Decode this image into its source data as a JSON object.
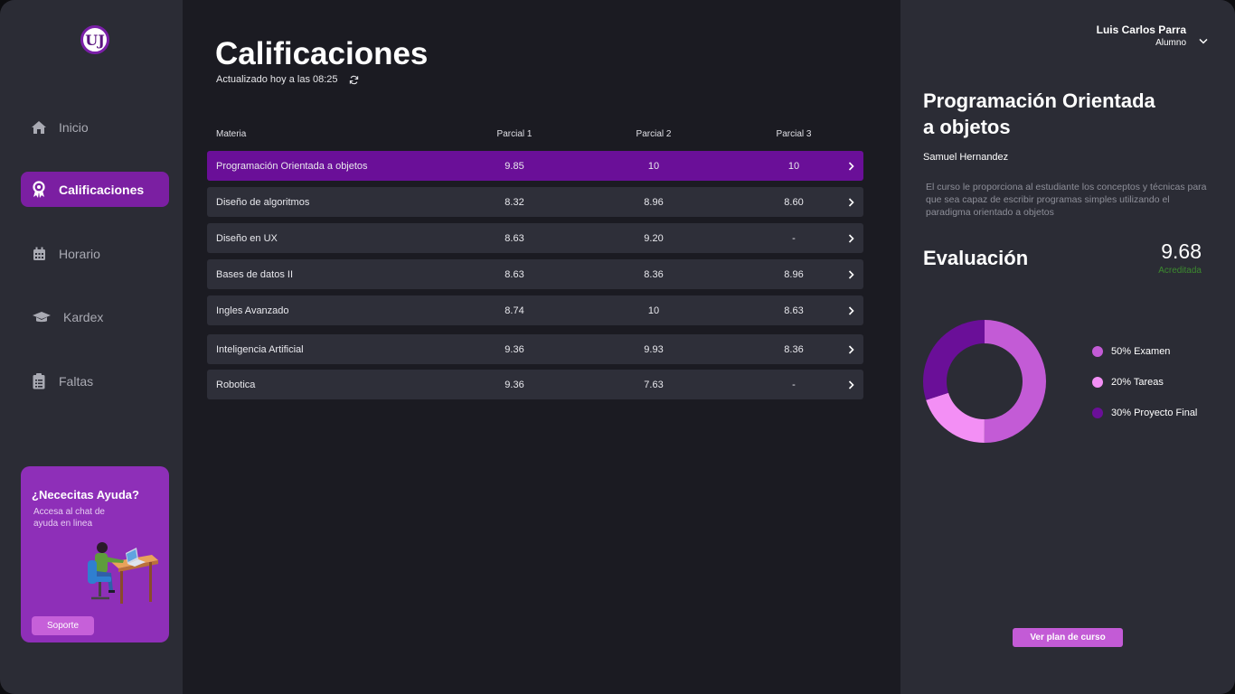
{
  "sidebar": {
    "logo_text": "UJ",
    "nav": [
      {
        "label": "Inicio",
        "icon": "home-icon"
      },
      {
        "label": "Calificaciones",
        "icon": "award-icon",
        "active": true
      },
      {
        "label": "Horario",
        "icon": "calendar-icon"
      },
      {
        "label": "Kardex",
        "icon": "graduation-cap-icon"
      },
      {
        "label": "Faltas",
        "icon": "clipboard-icon"
      }
    ],
    "help": {
      "title": "¿Nececitas Ayuda?",
      "subtitle": "Accesa al chat de ayuda en linea",
      "button": "Soporte"
    }
  },
  "main": {
    "title": "Calificaciones",
    "updated": "Actualizado hoy a las 08:25",
    "columns": [
      "Materia",
      "Parcial 1",
      "Parcial 2",
      "Parcial 3"
    ],
    "rows": [
      {
        "name": "Programación Orientada a objetos",
        "p1": "9.85",
        "p2": "10",
        "p3": "10",
        "selected": true
      },
      {
        "name": "Diseño de algoritmos",
        "p1": "8.32",
        "p2": "8.96",
        "p3": "8.60"
      },
      {
        "name": "Diseño en UX",
        "p1": "8.63",
        "p2": "9.20",
        "p3": "-"
      },
      {
        "name": "Bases de datos II",
        "p1": "8.63",
        "p2": "8.36",
        "p3": "8.96"
      },
      {
        "name": "Ingles Avanzado",
        "p1": "8.74",
        "p2": "10",
        "p3": "8.63"
      },
      {
        "name": "Inteligencia Artificial",
        "p1": "9.36",
        "p2": "9.93",
        "p3": "8.36"
      },
      {
        "name": "Robotica",
        "p1": "9.36",
        "p2": "7.63",
        "p3": "-"
      }
    ]
  },
  "user": {
    "name": "Luis Carlos Parra",
    "role": "Alumno"
  },
  "course": {
    "title": "Programación Orientada a objetos",
    "teacher": "Samuel Hernandez",
    "description": "El curso le proporciona al estudiante los conceptos y técnicas para que sea capaz de escribir programas simples utilizando el paradigma orientado a objetos",
    "evaluation_title": "Evaluación",
    "score": "9.68",
    "status": "Acreditada",
    "plan_button": "Ver plan de curso",
    "breakdown": [
      {
        "label": "50% Examen",
        "percent": 50,
        "color": "#c35bd6"
      },
      {
        "label": "20% Tareas",
        "percent": 20,
        "color": "#f38ff5"
      },
      {
        "label": "30% Proyecto Final",
        "percent": 30,
        "color": "#6a0f98"
      }
    ]
  },
  "colors": {
    "accent": "#7b1fa2",
    "selected_row": "#6a0f98",
    "status_ok": "#3c8a2f"
  }
}
